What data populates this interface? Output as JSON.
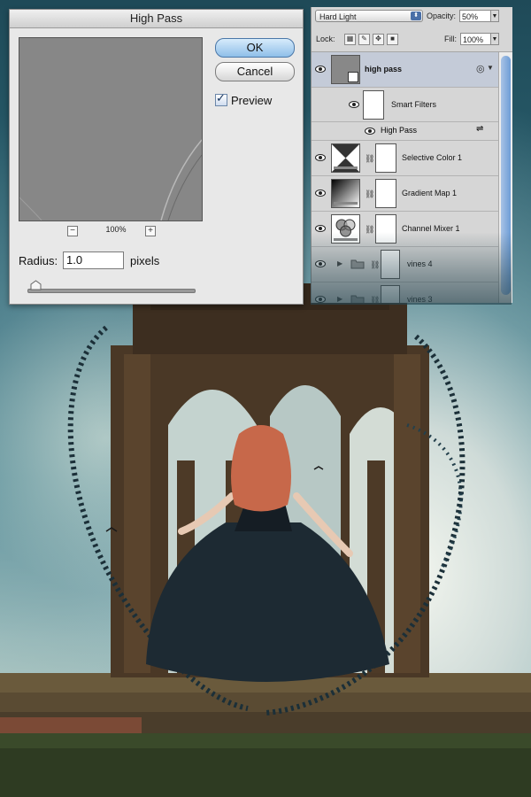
{
  "colors": {
    "dialog_bg": "#e8e8e8",
    "panel_bg": "#d6d6d6",
    "selected_row": "#c4cbd8",
    "default_button": "#8fbfe9"
  },
  "dialog": {
    "title": "High Pass",
    "ok_label": "OK",
    "cancel_label": "Cancel",
    "preview_label": "Preview",
    "preview_checked": true,
    "zoom_out": "−",
    "zoom_in": "+",
    "zoom_value": "100%",
    "radius_label": "Radius:",
    "radius_value": "1.0",
    "radius_unit": "pixels",
    "radius_slider_fraction": 0.02
  },
  "layers_panel": {
    "blend_mode": "Hard Light",
    "opacity_label": "Opacity:",
    "opacity_value": "50%",
    "lock_label": "Lock:",
    "fill_label": "Fill:",
    "fill_value": "100%",
    "layers": [
      {
        "name": "high pass",
        "selected": true,
        "icon": "smart-object-icon"
      },
      {
        "name": "Smart Filters",
        "type": "smart-filters"
      },
      {
        "name": "High Pass",
        "type": "filter"
      },
      {
        "name": "Selective Color 1",
        "icon": "selective-color-icon"
      },
      {
        "name": "Gradient Map 1",
        "icon": "gradient-map-icon"
      },
      {
        "name": "Channel Mixer 1",
        "icon": "channel-mixer-icon"
      },
      {
        "name": "vines 4",
        "type": "group"
      },
      {
        "name": "vines 3",
        "type": "group"
      }
    ]
  }
}
